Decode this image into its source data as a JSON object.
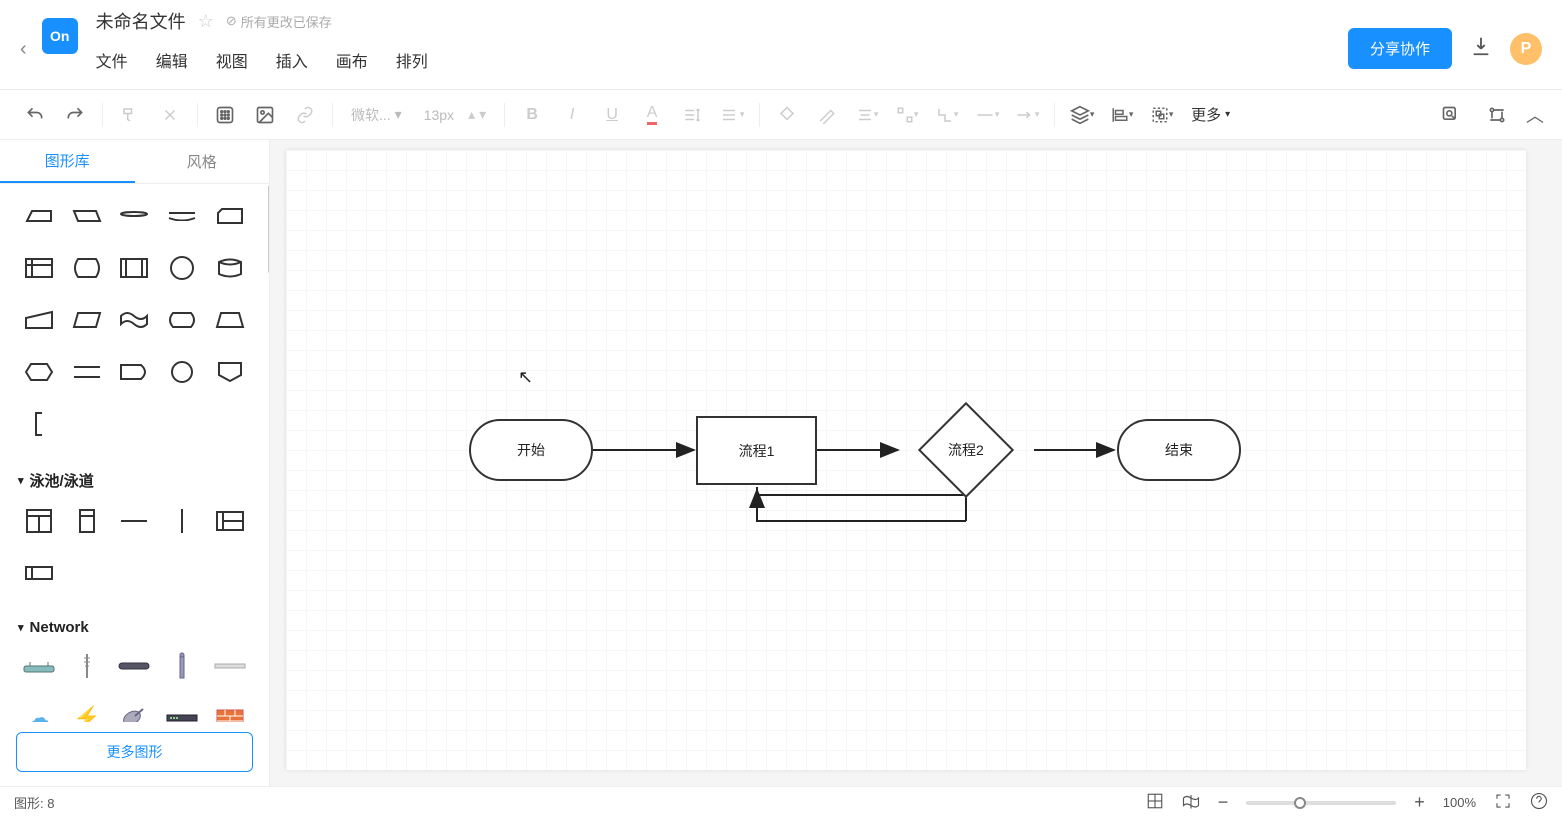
{
  "header": {
    "logo_text": "On",
    "doc_title": "未命名文件",
    "save_status": "所有更改已保存",
    "share_label": "分享协作",
    "avatar_letter": "P"
  },
  "menu": {
    "file": "文件",
    "edit": "编辑",
    "view": "视图",
    "insert": "插入",
    "canvas": "画布",
    "arrange": "排列"
  },
  "toolbar": {
    "font_name": "微软...",
    "font_size": "13px",
    "more_label": "更多"
  },
  "sidebar": {
    "tab_library": "图形库",
    "tab_style": "风格",
    "cat_pool": "泳池/泳道",
    "cat_network": "Network",
    "more_shapes": "更多图形"
  },
  "diagram": {
    "nodes": {
      "start": "开始",
      "proc1": "流程1",
      "proc2": "流程2",
      "end": "结束"
    }
  },
  "statusbar": {
    "shape_label": "图形:",
    "shape_count": "8",
    "zoom_pct": "100%"
  }
}
